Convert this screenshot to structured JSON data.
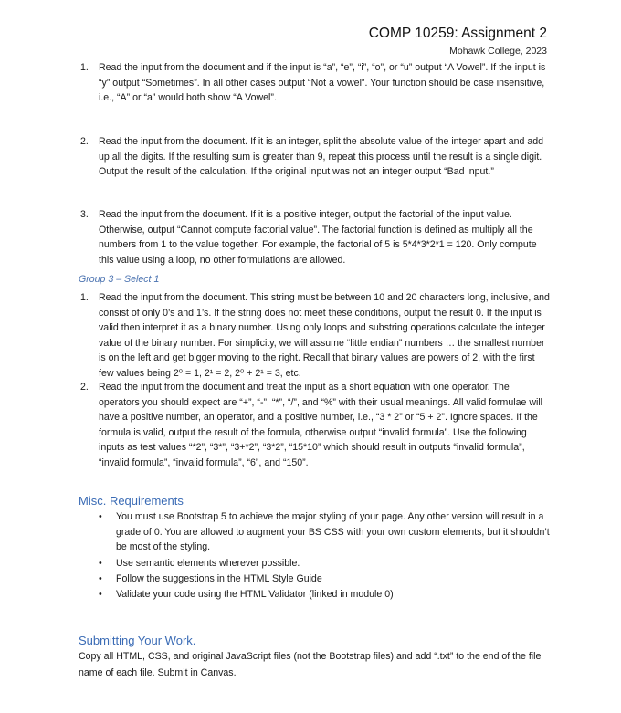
{
  "header": {
    "title": "COMP 10259: Assignment 2",
    "subtitle": "Mohawk College, 2023"
  },
  "group2_items": [
    {
      "number": "1.",
      "text": "Read the input from the document and if the input is “a”, “e”, “i”, “o”, or “u” output “A Vowel”. If the input is “y” output “Sometimes”. In all other cases output “Not a vowel”. Your function should be case insensitive, i.e., “A” or “a” would both show “A Vowel”."
    },
    {
      "number": "2.",
      "text": "Read the input from the document. If it is an integer, split the absolute value of the integer apart and add up all the digits. If the resulting sum is greater than 9, repeat this process until the result is a single digit. Output the result of the calculation. If the original input was not an integer output “Bad input.”"
    },
    {
      "number": "3.",
      "text": "Read the input from the document. If it is a positive integer, output the factorial of the input value. Otherwise, output “Cannot compute factorial value”. The factorial function is defined as multiply all the numbers from 1 to the value together. For example, the factorial of 5 is 5*4*3*2*1 = 120. Only compute this value using a loop, no other formulations are allowed."
    }
  ],
  "group3": {
    "heading": "Group 3 – Select 1",
    "items": [
      {
        "number": "1.",
        "text": "Read the input from the document. This string must be between 10 and 20 characters long, inclusive, and consist of only 0’s and 1’s. If the string does not meet these conditions, output the result 0. If the input is valid then interpret it as a binary number. Using only loops and substring operations calculate the integer value of the binary number. For simplicity, we will assume “little endian” numbers … the smallest number is on the left and get bigger moving to the right. Recall that binary values are powers of 2, with the first few values being ",
        "formula": "2⁰ = 1, 2¹ = 2, 2⁰ + 2¹ = 3, etc."
      },
      {
        "number": "2.",
        "text": "Read the input from the document and treat the input as a short equation with one operator. The operators you should expect are “+”, “-”, “*”, “/”, and “%” with their usual meanings. All valid formulae will have a positive number, an operator, and a positive number, i.e., “3 * 2” or “5 + 2”. Ignore spaces. If the formula is valid, output the result of the formula, otherwise output “invalid formula”. Use the following inputs as test values “*2”, “3*”, “3+*2”, “3*2”, “15*10” which should result in outputs “invalid formula”, “invalid formula”, “invalid formula”, “6”, and “150”."
      }
    ]
  },
  "misc": {
    "heading": "Misc. Requirements",
    "bullets": [
      {
        "symbol": "•",
        "text": "You must use Bootstrap 5 to achieve the major styling of your page. Any other version will result in a grade of 0. You are allowed to augment your BS CSS with your own custom elements, but it shouldn’t be most of the styling."
      },
      {
        "symbol": "•",
        "text": "Use semantic elements wherever possible."
      },
      {
        "symbol": "•",
        "text": "Follow the suggestions in the HTML Style Guide"
      },
      {
        "symbol": "•",
        "text": "Validate your code using the HTML Validator (linked in module 0)"
      }
    ]
  },
  "submitting": {
    "heading": "Submitting Your Work.",
    "text": "Copy all HTML, CSS, and original JavaScript files (not the Bootstrap files) and add “.txt” to the end of the file name of each file. Submit in Canvas."
  }
}
